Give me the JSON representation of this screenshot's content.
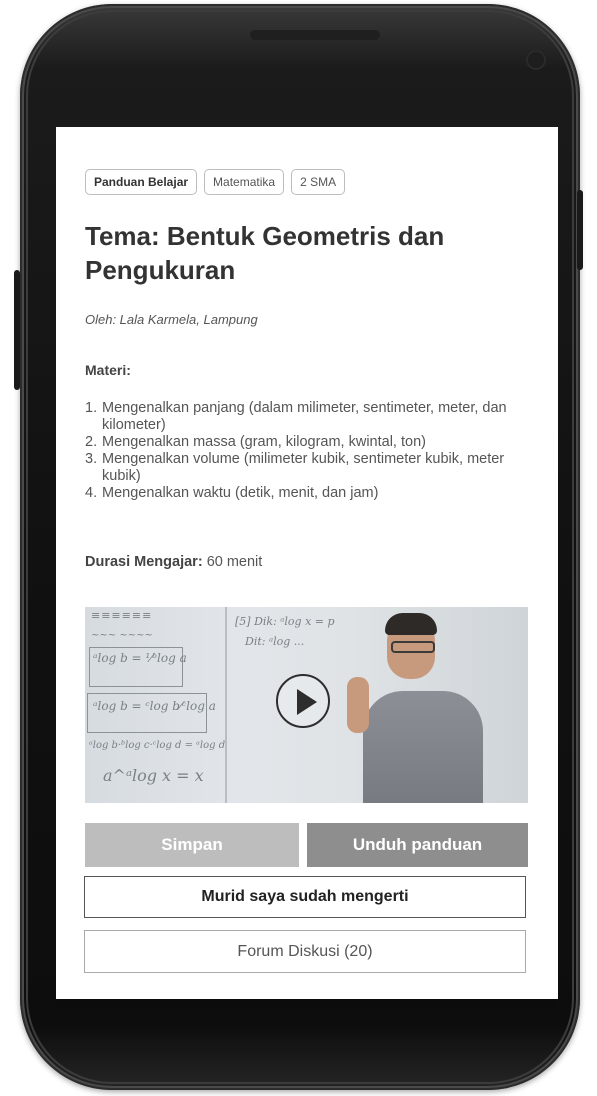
{
  "tags": [
    {
      "label": "Panduan Belajar"
    },
    {
      "label": "Matematika"
    },
    {
      "label": "2 SMA"
    }
  ],
  "lesson": {
    "title": "Tema: Bentuk Geometris dan Pengukuran",
    "author": "Oleh: Lala Karmela, Lampung",
    "materi_label": "Materi:",
    "materi_items": [
      {
        "num": "1.",
        "text": "Mengenalkan panjang (dalam milimeter, sentimeter, meter, dan kilometer)"
      },
      {
        "num": "2.",
        "text": "Mengenalkan massa (gram, kilogram, kwintal, ton)"
      },
      {
        "num": "3.",
        "text": "Mengenalkan volume (milimeter kubik, sentimeter kubik, meter kubik)"
      },
      {
        "num": "4.",
        "text": "Mengenalkan waktu (detik, menit, dan jam)"
      }
    ],
    "durasi_label": "Durasi Mengajar:",
    "durasi_value": "60 menit"
  },
  "video": {
    "play_icon": "play-icon"
  },
  "actions": {
    "simpan_label": "Simpan",
    "unduh_label": "Unduh panduan",
    "mengerti_label": "Murid saya sudah mengerti",
    "forum_label": "Forum Diskusi (20)"
  }
}
